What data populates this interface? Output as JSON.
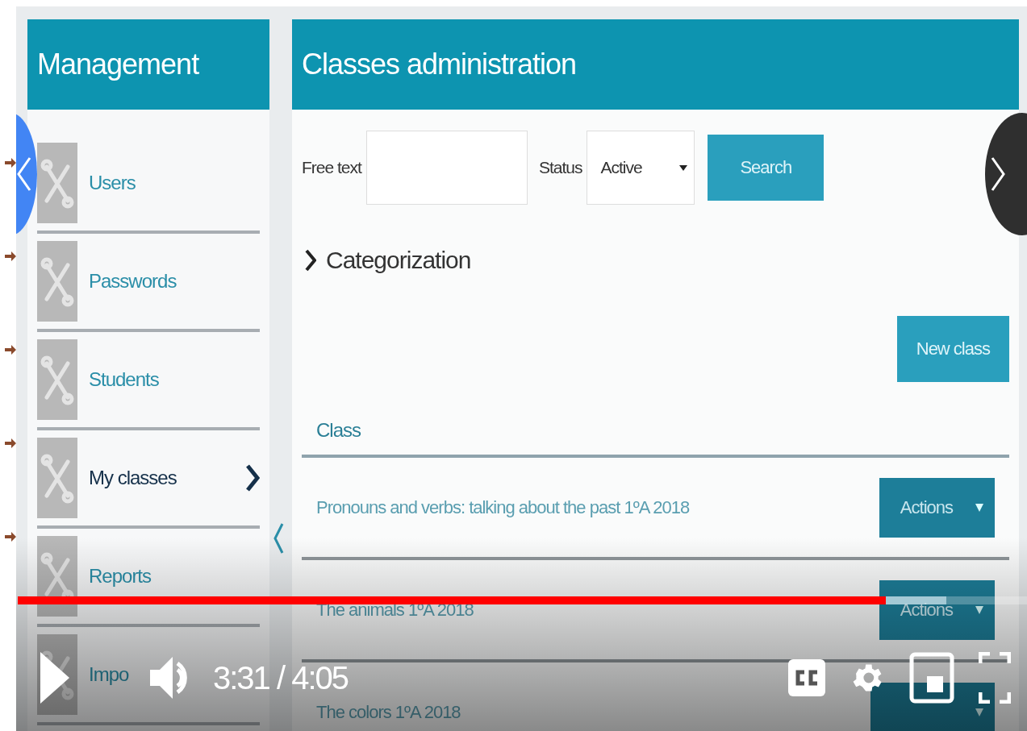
{
  "sidebar": {
    "title": "Management",
    "items": [
      {
        "label": "Users",
        "selected": false
      },
      {
        "label": "Passwords",
        "selected": false
      },
      {
        "label": "Students",
        "selected": false
      },
      {
        "label": "My classes",
        "selected": true
      },
      {
        "label": "Reports",
        "selected": false
      },
      {
        "label": "Impo",
        "selected": false
      }
    ]
  },
  "main": {
    "title": "Classes administration",
    "free_text_label": "Free text",
    "status_label": "Status",
    "status_value": "Active",
    "search_button": "Search",
    "categorization": "Categorization",
    "new_class_button": "New class",
    "table": {
      "column": "Class",
      "rows": [
        {
          "name": "Pronouns and verbs: talking about the past 1ºA 2018",
          "action": "Actions"
        },
        {
          "name": "The animals 1ºA 2018",
          "action": "Actions"
        },
        {
          "name": "The colors 1ºA 2018"
        }
      ]
    }
  },
  "player": {
    "time": "3:31 / 4:05",
    "level": 0.86
  }
}
